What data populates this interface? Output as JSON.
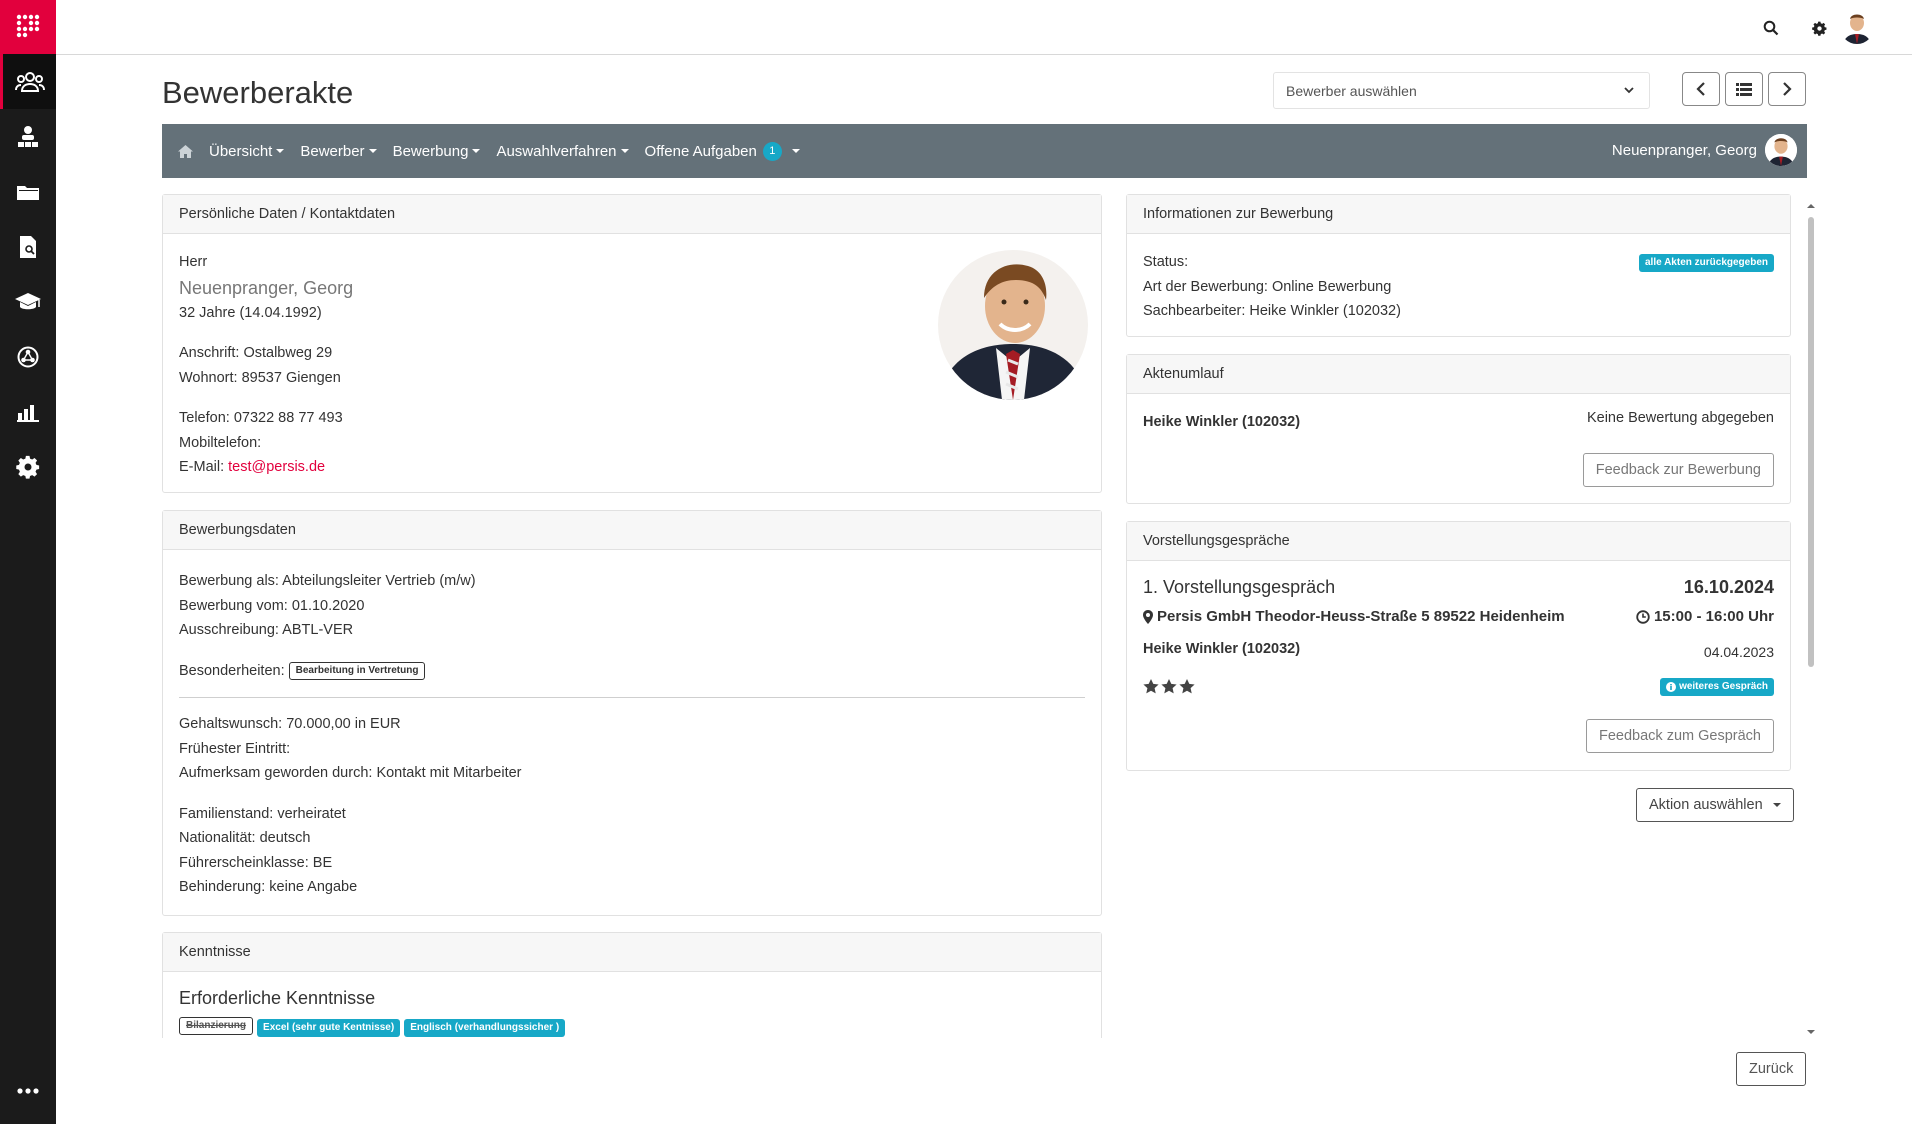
{
  "page": {
    "title": "Bewerberakte"
  },
  "topbar": {
    "search_icon": "search-icon",
    "settings_icon": "gear-icon"
  },
  "sidebar": {
    "items": [
      {
        "icon": "users-icon",
        "active": true
      },
      {
        "icon": "org-chart-icon"
      },
      {
        "icon": "folder-icon"
      },
      {
        "icon": "document-search-icon"
      },
      {
        "icon": "graduation-cap-icon"
      },
      {
        "icon": "network-icon"
      },
      {
        "icon": "bar-chart-icon"
      },
      {
        "icon": "gear-icon"
      }
    ],
    "more_icon": "more-dots-icon"
  },
  "applicant_select": {
    "placeholder": "Bewerber auswählen"
  },
  "navbar": {
    "home_icon": "home-icon",
    "items": [
      "Übersicht",
      "Bewerber",
      "Bewerbung",
      "Auswahlverfahren",
      "Offene Aufgaben"
    ],
    "task_count": "1",
    "user": "Neuenpranger, Georg"
  },
  "personal": {
    "header": "Persönliche Daten / Kontaktdaten",
    "salutation": "Herr",
    "name": "Neuenpranger, Georg",
    "age": "32 Jahre (14.04.1992)",
    "address": "Anschrift: Ostalbweg 29",
    "city": "Wohnort: 89537 Giengen",
    "phone": "Telefon: 07322 88 77 493",
    "mobile": "Mobiltelefon:",
    "email_label": "E-Mail: ",
    "email": "test@persis.de"
  },
  "application": {
    "header": "Bewerbungsdaten",
    "position": "Bewerbung als: Abteilungsleiter Vertrieb (m/w)",
    "date": "Bewerbung vom: 01.10.2020",
    "posting": "Ausschreibung: ABTL-VER",
    "special_label": "Besonderheiten:",
    "special_tag": "Bearbeitung in Vertretung",
    "salary": "Gehaltswunsch: 70.000,00 in EUR",
    "earliest": "Frühester Eintritt:",
    "source": "Aufmerksam geworden durch: Kontakt mit Mitarbeiter",
    "marital": "Familienstand: verheiratet",
    "nationality": "Nationalität: deutsch",
    "license": "Führerscheinklasse: BE",
    "disability": "Behinderung: keine Angabe"
  },
  "skills": {
    "header": "Kenntnisse",
    "title": "Erforderliche Kenntnisse",
    "tags": [
      "Bilanzierung",
      "Excel (sehr gute Kentnisse)",
      "Englisch (verhandlungssicher )"
    ]
  },
  "info": {
    "header": "Informationen zur Bewerbung",
    "status": "Status:",
    "status_badge": "alle Akten zurückgegeben",
    "type": "Art der Bewerbung: Online Bewerbung",
    "clerk": "Sachbearbeiter: Heike Winkler (102032)"
  },
  "circulation": {
    "header": "Aktenumlauf",
    "person": "Heike Winkler (102032)",
    "state": "Keine Bewertung abgegeben",
    "button": "Feedback zur Bewerbung"
  },
  "interviews": {
    "header": "Vorstellungsgespräche",
    "title": "1. Vorstellungsgespräch",
    "date": "16.10.2024",
    "location": "Persis GmbH Theodor-Heuss-Straße 5 89522 Heidenheim",
    "time": "15:00 - 16:00 Uhr",
    "interviewer": "Heike Winkler (102032)",
    "rating_date": "04.04.2023",
    "rating": 3,
    "badge": "weiteres Gespräch",
    "button": "Feedback zum Gespräch"
  },
  "action_button": "Aktion auswählen",
  "back_button": "Zurück",
  "colors": {
    "brand": "#e2003d",
    "navbar": "#647179",
    "accent": "#17a8c7",
    "sidebar": "#1b1b1b"
  }
}
